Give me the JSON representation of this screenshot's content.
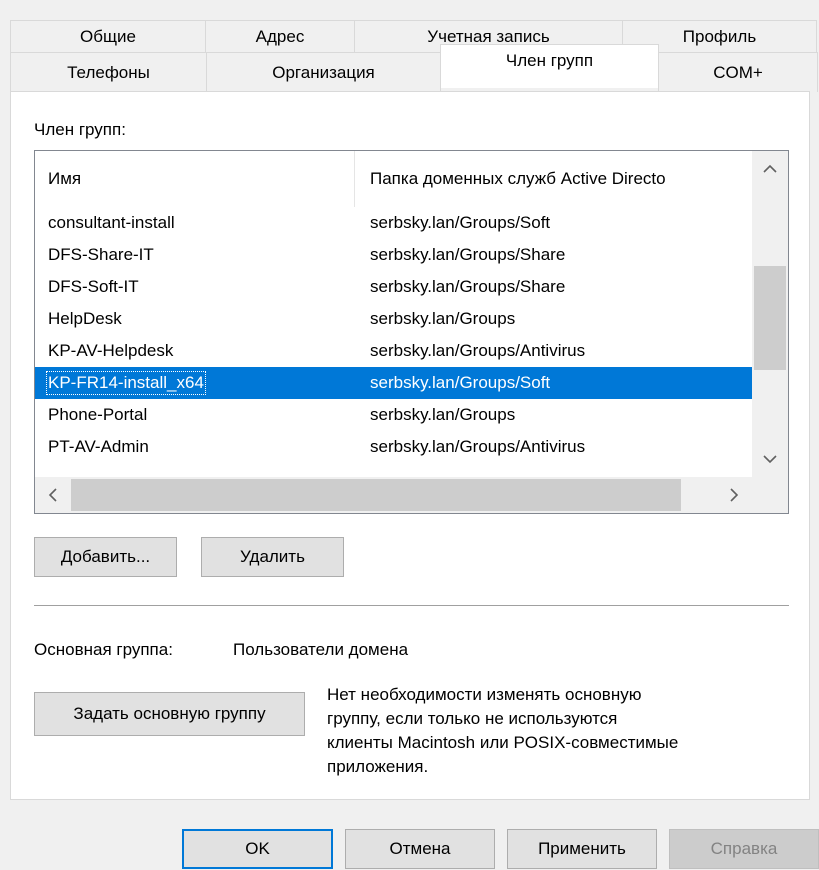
{
  "tabs": {
    "row1": [
      "Общие",
      "Адрес",
      "Учетная запись",
      "Профиль"
    ],
    "row2": [
      "Телефоны",
      "Организация",
      "Член групп",
      "COM+"
    ],
    "active": "Член групп"
  },
  "member_of": {
    "label": "Член групп:",
    "columns": [
      "Имя",
      "Папка доменных служб Active Directo"
    ],
    "rows": [
      [
        "consultant-install",
        "serbsky.lan/Groups/Soft"
      ],
      [
        "DFS-Share-IT",
        "serbsky.lan/Groups/Share"
      ],
      [
        "DFS-Soft-IT",
        "serbsky.lan/Groups/Share"
      ],
      [
        "HelpDesk",
        "serbsky.lan/Groups"
      ],
      [
        "KP-AV-Helpdesk",
        "serbsky.lan/Groups/Antivirus"
      ],
      [
        "KP-FR14-install_x64",
        "serbsky.lan/Groups/Soft"
      ],
      [
        "Phone-Portal",
        "serbsky.lan/Groups"
      ],
      [
        "PT-AV-Admin",
        "serbsky.lan/Groups/Antivirus"
      ]
    ],
    "selected_row": 5,
    "icons": {
      "up": "▲",
      "down": "▼",
      "left": "‹",
      "right": "›"
    }
  },
  "buttons": {
    "add": "Добавить...",
    "remove": "Удалить",
    "set_primary": "Задать основную группу",
    "ok": "OK",
    "cancel": "Отмена",
    "apply": "Применить",
    "help": "Справка"
  },
  "primary_group": {
    "label": "Основная группа:",
    "value": "Пользователи домена",
    "note": "Нет необходимости изменять основную\nгруппу, если только не используются\nклиенты Macintosh или POSIX-совместимые\nприложения."
  },
  "colors": {
    "selection": "#0078d7",
    "default_button_border": "#0078d7"
  }
}
